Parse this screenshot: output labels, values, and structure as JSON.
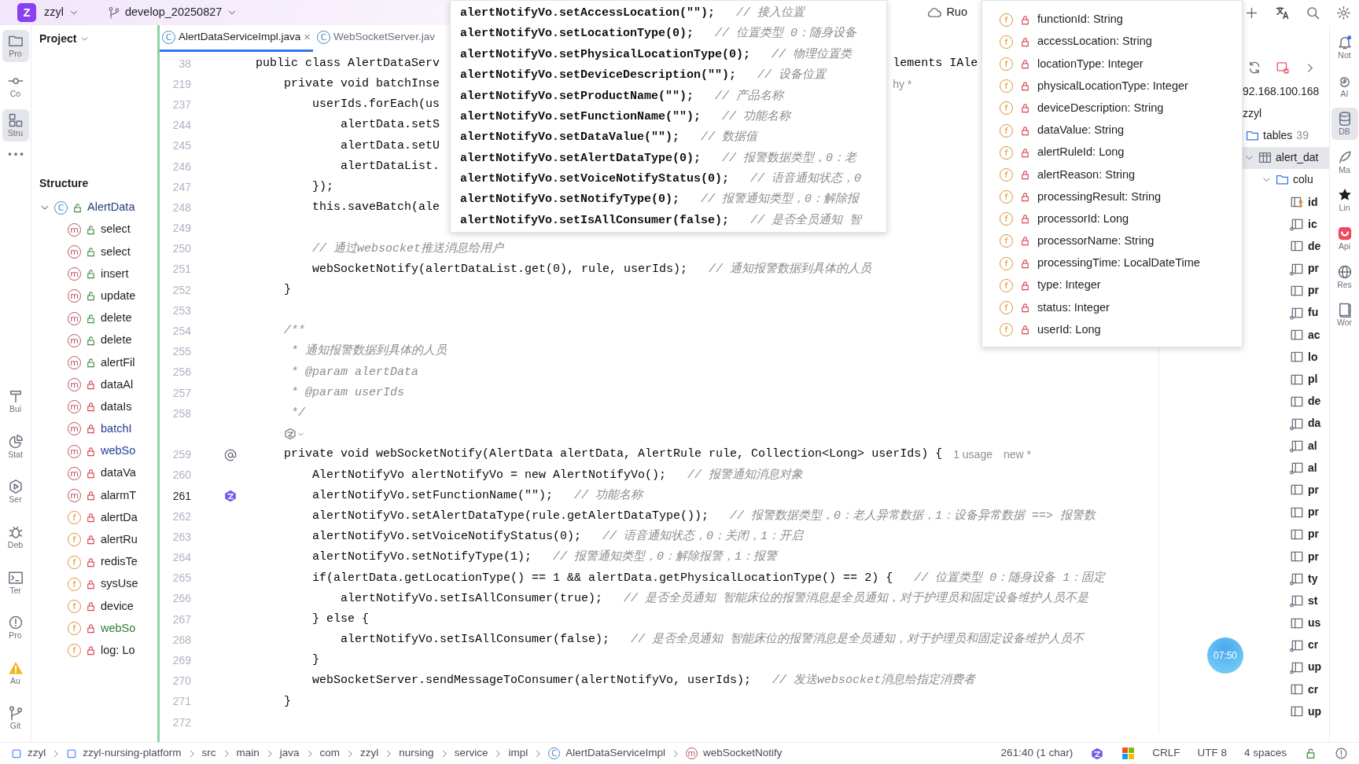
{
  "top_bar": {
    "logo": "Z",
    "project": "zzyl",
    "branch": "develop_20250827",
    "run_config": "Ruo"
  },
  "left_toolbar": {
    "top": [
      {
        "kind": "folder",
        "label": "Pro",
        "selected": true
      },
      {
        "kind": "commit",
        "label": "Co",
        "selected": false
      },
      {
        "kind": "structure",
        "label": "Stru",
        "selected": true
      },
      {
        "kind": "more",
        "selected": false
      }
    ],
    "bottom": [
      {
        "kind": "hammer",
        "label": "Bui",
        "selected": false
      },
      {
        "kind": "pie",
        "label": "Stat",
        "selected": false
      },
      {
        "kind": "services",
        "label": "Ser",
        "selected": false
      },
      {
        "kind": "bug",
        "label": "Deb",
        "selected": false
      },
      {
        "kind": "terminal",
        "label": "Ter",
        "selected": false
      },
      {
        "kind": "problems",
        "label": "Pro",
        "selected": false
      },
      {
        "kind": "warning",
        "label": "Au",
        "selected": false
      },
      {
        "kind": "git",
        "label": "Git",
        "selected": false
      }
    ]
  },
  "project_panel": {
    "title": "Project"
  },
  "structure": {
    "title": "Structure",
    "root": {
      "kind": "class",
      "icon_letter": "C",
      "locked": false,
      "name": "AlertData",
      "color": "#23407a",
      "expanded": true,
      "children": [
        {
          "kind": "method",
          "icon_letter": "m",
          "locked": false,
          "name": "select",
          "color": "#1e1f22"
        },
        {
          "kind": "method",
          "icon_letter": "m",
          "locked": false,
          "name": "select",
          "color": "#1e1f22"
        },
        {
          "kind": "method",
          "icon_letter": "m",
          "locked": false,
          "name": "insert",
          "color": "#1e1f22"
        },
        {
          "kind": "method",
          "icon_letter": "m",
          "locked": false,
          "name": "update",
          "color": "#1e1f22"
        },
        {
          "kind": "method",
          "icon_letter": "m",
          "locked": false,
          "name": "delete",
          "color": "#1e1f22"
        },
        {
          "kind": "method",
          "icon_letter": "m",
          "locked": false,
          "name": "delete",
          "color": "#1e1f22"
        },
        {
          "kind": "method",
          "icon_letter": "m",
          "locked": false,
          "name": "alertFil",
          "color": "#1e1f22"
        },
        {
          "kind": "method",
          "icon_letter": "m",
          "locked": true,
          "name": "dataAl",
          "color": "#1e1f22"
        },
        {
          "kind": "method",
          "icon_letter": "m",
          "locked": true,
          "name": "dataIs",
          "color": "#1e1f22"
        },
        {
          "kind": "method",
          "icon_letter": "m",
          "locked": true,
          "name": "batchI",
          "color": "#233d8f"
        },
        {
          "kind": "method",
          "icon_letter": "m",
          "locked": true,
          "name": "webSo",
          "color": "#233d8f"
        },
        {
          "kind": "method",
          "icon_letter": "m",
          "locked": true,
          "name": "dataVa",
          "color": "#1e1f22"
        },
        {
          "kind": "method",
          "icon_letter": "m",
          "locked": true,
          "name": "alarmT",
          "color": "#1e1f22"
        },
        {
          "kind": "field",
          "icon_letter": "f",
          "locked": true,
          "name": "alertDa",
          "color": "#1e1f22"
        },
        {
          "kind": "field",
          "icon_letter": "f",
          "locked": true,
          "name": "alertRu",
          "color": "#1e1f22"
        },
        {
          "kind": "field",
          "icon_letter": "f",
          "locked": true,
          "name": "redisTe",
          "color": "#1e1f22"
        },
        {
          "kind": "field",
          "icon_letter": "f",
          "locked": true,
          "name": "sysUse",
          "color": "#1e1f22"
        },
        {
          "kind": "field",
          "icon_letter": "f",
          "locked": true,
          "name": "device",
          "color": "#1e1f22"
        },
        {
          "kind": "field",
          "icon_letter": "f",
          "locked": true,
          "name": "webSo",
          "color": "#2e7d32"
        },
        {
          "kind": "field",
          "icon_letter": "f",
          "locked": true,
          "name": "log: Lo",
          "color": "#1e1f22"
        }
      ]
    }
  },
  "tabs": [
    {
      "icon_letter": "C",
      "label": "AlertDataServiceImpl.java",
      "selected": true,
      "close": "×"
    },
    {
      "icon_letter": "C",
      "label": "WebSocketServer.jav",
      "selected": false
    }
  ],
  "editor_lines": [
    {
      "kind": "code",
      "num": "38",
      "current": false,
      "code": "public class AlertDataServ",
      "tail": {
        "kind": "code",
        "text": "lements IAle"
      }
    },
    {
      "kind": "code",
      "num": "219",
      "current": false,
      "code": "    private void batchInse",
      "tail": {
        "kind": "hint",
        "text": "hy *"
      }
    },
    {
      "kind": "code",
      "num": "237",
      "current": false,
      "code": "        userIds.forEach(us"
    },
    {
      "kind": "code",
      "num": "244",
      "current": false,
      "code": "            alertData.setS"
    },
    {
      "kind": "code",
      "num": "245",
      "current": false,
      "code": "            alertData.setU"
    },
    {
      "kind": "code",
      "num": "246",
      "current": false,
      "code": "            alertDataList."
    },
    {
      "kind": "code",
      "num": "247",
      "current": false,
      "code": "        });"
    },
    {
      "kind": "code",
      "num": "248",
      "current": false,
      "code": "        this.saveBatch(ale"
    },
    {
      "kind": "code",
      "num": "249",
      "current": false
    },
    {
      "kind": "code",
      "num": "250",
      "current": false,
      "comment": "        // 通过websocket推送消息给用户"
    },
    {
      "kind": "code",
      "num": "251",
      "current": false,
      "code": "        webSocketNotify(alertDataList.get(0), rule, userIds);",
      "comment": "// 通知报警数据到具体的人员"
    },
    {
      "kind": "code",
      "num": "252",
      "current": false,
      "code": "    }"
    },
    {
      "kind": "code",
      "num": "253",
      "current": false
    },
    {
      "kind": "code",
      "num": "254",
      "current": false,
      "comment": "    /**"
    },
    {
      "kind": "code",
      "num": "255",
      "current": false,
      "comment": "     * 通知报警数据到具体的人员"
    },
    {
      "kind": "code",
      "num": "256",
      "current": false,
      "comment": "     * @param alertData"
    },
    {
      "kind": "code",
      "num": "257",
      "current": false,
      "comment": "     * @param userIds"
    },
    {
      "kind": "code",
      "num": "258",
      "current": false,
      "comment": "     */"
    },
    {
      "kind": "hint"
    },
    {
      "kind": "code",
      "num": "259",
      "current": false,
      "gutter": {
        "kind": "at"
      },
      "code": "    private void webSocketNotify(AlertData alertData, AlertRule rule, Collection<Long> userIds) {",
      "hints": [
        "1 usage",
        "new *"
      ]
    },
    {
      "kind": "code",
      "num": "260",
      "current": false,
      "code": "        AlertNotifyVo alertNotifyVo = new AlertNotifyVo();",
      "comment": "// 报警通知消息对象"
    },
    {
      "kind": "code",
      "num": "261",
      "current": true,
      "gutter": {
        "kind": "ai"
      },
      "code": "        alertNotifyVo.setFunctionName(\"\");",
      "comment": "// 功能名称"
    },
    {
      "kind": "code",
      "num": "262",
      "current": false,
      "code": "        alertNotifyVo.setAlertDataType(rule.getAlertDataType());",
      "comment": "// 报警数据类型，0：老人异常数据，1：设备异常数据 ==> 报警数"
    },
    {
      "kind": "code",
      "num": "263",
      "current": false,
      "code": "        alertNotifyVo.setVoiceNotifyStatus(0);",
      "comment": "// 语音通知状态，0：关闭，1：开启"
    },
    {
      "kind": "code",
      "num": "264",
      "current": false,
      "code": "        alertNotifyVo.setNotifyType(1);",
      "comment": "// 报警通知类型，0：解除报警，1：报警"
    },
    {
      "kind": "code",
      "num": "265",
      "current": false,
      "code": "        if(alertData.getLocationType() == 1 && alertData.getPhysicalLocationType() == 2) {",
      "comment": "// 位置类型 0：随身设备 1：固定"
    },
    {
      "kind": "code",
      "num": "266",
      "current": false,
      "code": "            alertNotifyVo.setIsAllConsumer(true);",
      "comment": "// 是否全员通知 智能床位的报警消息是全员通知，对于护理员和固定设备维护人员不是"
    },
    {
      "kind": "code",
      "num": "267",
      "current": false,
      "code": "        } else {"
    },
    {
      "kind": "code",
      "num": "268",
      "current": false,
      "code": "            alertNotifyVo.setIsAllConsumer(false);",
      "comment": "// 是否全员通知 智能床位的报警消息是全员通知，对于护理员和固定设备维护人员不"
    },
    {
      "kind": "code",
      "num": "269",
      "current": false,
      "code": "        }"
    },
    {
      "kind": "code",
      "num": "270",
      "current": false,
      "code": "        webSocketServer.sendMessageToConsumer(alertNotifyVo, userIds);",
      "comment": "// 发送websocket消息给指定消费者"
    },
    {
      "kind": "code",
      "num": "271",
      "current": false,
      "code": "    }"
    },
    {
      "kind": "code",
      "num": "272",
      "current": false
    }
  ],
  "code_popup": [
    {
      "code": "alertNotifyVo.setAccessLocation(\"\");",
      "comment": "// 接入位置"
    },
    {
      "code": "alertNotifyVo.setLocationType(0);",
      "comment": "// 位置类型 0：随身设备"
    },
    {
      "code": "alertNotifyVo.setPhysicalLocationType(0);",
      "comment": "// 物理位置类"
    },
    {
      "code": "alertNotifyVo.setDeviceDescription(\"\");",
      "comment": "// 设备位置"
    },
    {
      "code": "alertNotifyVo.setProductName(\"\");",
      "comment": "// 产品名称"
    },
    {
      "code": "alertNotifyVo.setFunctionName(\"\");",
      "comment": "// 功能名称"
    },
    {
      "code": "alertNotifyVo.setDataValue(\"\");",
      "comment": "// 数据值"
    },
    {
      "code": "alertNotifyVo.setAlertDataType(0);",
      "comment": "// 报警数据类型，0：老"
    },
    {
      "code": "alertNotifyVo.setVoiceNotifyStatus(0);",
      "comment": "// 语音通知状态，0"
    },
    {
      "code": "alertNotifyVo.setNotifyType(0);",
      "comment": "// 报警通知类型，0：解除报"
    },
    {
      "code": "alertNotifyVo.setIsAllConsumer(false);",
      "comment": "// 是否全员通知 智"
    }
  ],
  "fields_popup": [
    {
      "icon_letter": "f",
      "name": "functionId: String"
    },
    {
      "icon_letter": "f",
      "name": "accessLocation: String"
    },
    {
      "icon_letter": "f",
      "name": "locationType: Integer"
    },
    {
      "icon_letter": "f",
      "name": "physicalLocationType: Integer"
    },
    {
      "icon_letter": "f",
      "name": "deviceDescription: String"
    },
    {
      "icon_letter": "f",
      "name": "dataValue: String"
    },
    {
      "icon_letter": "f",
      "name": "alertRuleId: Long"
    },
    {
      "icon_letter": "f",
      "name": "alertReason: String"
    },
    {
      "icon_letter": "f",
      "name": "processingResult: String"
    },
    {
      "icon_letter": "f",
      "name": "processorId: Long"
    },
    {
      "icon_letter": "f",
      "name": "processorName: String"
    },
    {
      "icon_letter": "f",
      "name": "processingTime: LocalDateTime"
    },
    {
      "icon_letter": "f",
      "name": "type: Integer"
    },
    {
      "icon_letter": "f",
      "name": "status: Integer"
    },
    {
      "icon_letter": "f",
      "name": "userId: Long"
    }
  ],
  "db_panel": {
    "host": "92.168.100.168",
    "schema": "zzyl",
    "tables_label": "tables",
    "tables_count": "39",
    "table": {
      "name": "alert_dat",
      "selected": true,
      "expanded": true
    },
    "columns_folder": {
      "label": "colu",
      "expanded": true
    },
    "columns": [
      {
        "name": "id",
        "kind": "key"
      },
      {
        "name": "ic",
        "kind": "nn"
      },
      {
        "name": "de",
        "kind": "col"
      },
      {
        "name": "pr",
        "kind": "nn"
      },
      {
        "name": "pr",
        "kind": "col"
      },
      {
        "name": "fu",
        "kind": "nn"
      },
      {
        "name": "ac",
        "kind": "col"
      },
      {
        "name": "lo",
        "kind": "col"
      },
      {
        "name": "pl",
        "kind": "col"
      },
      {
        "name": "de",
        "kind": "col"
      },
      {
        "name": "da",
        "kind": "nn"
      },
      {
        "name": "al",
        "kind": "nn"
      },
      {
        "name": "al",
        "kind": "nn"
      },
      {
        "name": "pr",
        "kind": "col"
      },
      {
        "name": "pr",
        "kind": "col"
      },
      {
        "name": "pr",
        "kind": "col"
      },
      {
        "name": "pr",
        "kind": "col"
      },
      {
        "name": "ty",
        "kind": "nn"
      },
      {
        "name": "st",
        "kind": "nn"
      },
      {
        "name": "us",
        "kind": "col"
      },
      {
        "name": "cr",
        "kind": "nn"
      },
      {
        "name": "up",
        "kind": "nn"
      },
      {
        "name": "cr",
        "kind": "col"
      },
      {
        "name": "up",
        "kind": "col"
      }
    ]
  },
  "right_toolbar": [
    {
      "kind": "bell",
      "label": "Not",
      "selected": false
    },
    {
      "kind": "spiral",
      "label": "AI",
      "selected": false
    },
    {
      "kind": "db",
      "label": "DB",
      "selected": true
    },
    {
      "kind": "feather",
      "label": "Ma",
      "selected": false
    },
    {
      "kind": "star",
      "label": "Lin",
      "selected": false
    },
    {
      "kind": "app",
      "label": "Api",
      "selected": false
    },
    {
      "kind": "globe",
      "label": "Res",
      "selected": false
    },
    {
      "kind": "book",
      "label": "Wor",
      "selected": false
    }
  ],
  "timer": "07:50",
  "status_bar": {
    "breadcrumbs": [
      {
        "kind": "module",
        "text": "zzyl"
      },
      {
        "kind": "module",
        "text": "zzyl-nursing-platform"
      },
      {
        "kind": "plain",
        "text": "src"
      },
      {
        "kind": "plain",
        "text": "main"
      },
      {
        "kind": "plain",
        "text": "java"
      },
      {
        "kind": "plain",
        "text": "com"
      },
      {
        "kind": "plain",
        "text": "zzyl"
      },
      {
        "kind": "plain",
        "text": "nursing"
      },
      {
        "kind": "plain",
        "text": "service"
      },
      {
        "kind": "plain",
        "text": "impl"
      },
      {
        "kind": "class",
        "icon_letter": "C",
        "text": "AlertDataServiceImpl"
      },
      {
        "kind": "method",
        "icon_letter": "m",
        "text": "webSocketNotify"
      }
    ],
    "position": "261:40 (1 char)",
    "line_separator": "CRLF",
    "encoding": "UTF 8",
    "indent": "4 spaces"
  }
}
